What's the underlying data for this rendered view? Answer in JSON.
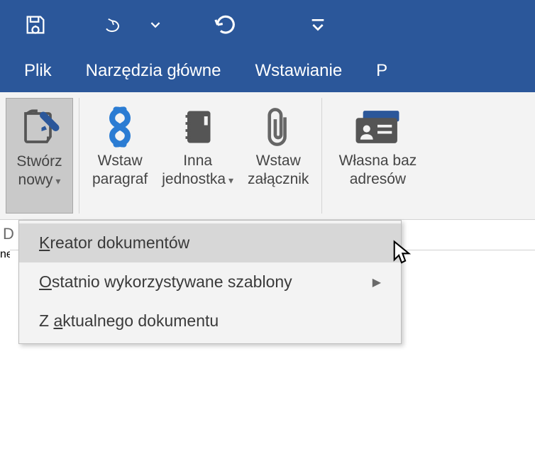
{
  "qat": {
    "save_icon": "save-refresh",
    "undo_icon": "undo",
    "redo_icon": "redo",
    "customize_icon": "customize"
  },
  "tabs": {
    "file": "Plik",
    "home": "Narzędzia główne",
    "insert": "Wstawianie",
    "next_partial": "P"
  },
  "ribbon": {
    "create_new": {
      "line1": "Stwórz",
      "line2": "nowy"
    },
    "insert_paragraph": {
      "line1": "Wstaw",
      "line2": "paragraf"
    },
    "other_unit": {
      "line1": "Inna",
      "line2": "jednostka"
    },
    "insert_attachment": {
      "line1": "Wstaw",
      "line2": "załącznik"
    },
    "own_address_db": {
      "line1": "Własna baz",
      "line2": "adresów"
    }
  },
  "below": {
    "left_letter": "D",
    "right_partial": "ne adreso"
  },
  "dropdown": {
    "item1": "Kreator dokumentów",
    "item2": "Ostatnio wykorzystywane szablony",
    "item3": "Z aktualnego dokumentu"
  }
}
